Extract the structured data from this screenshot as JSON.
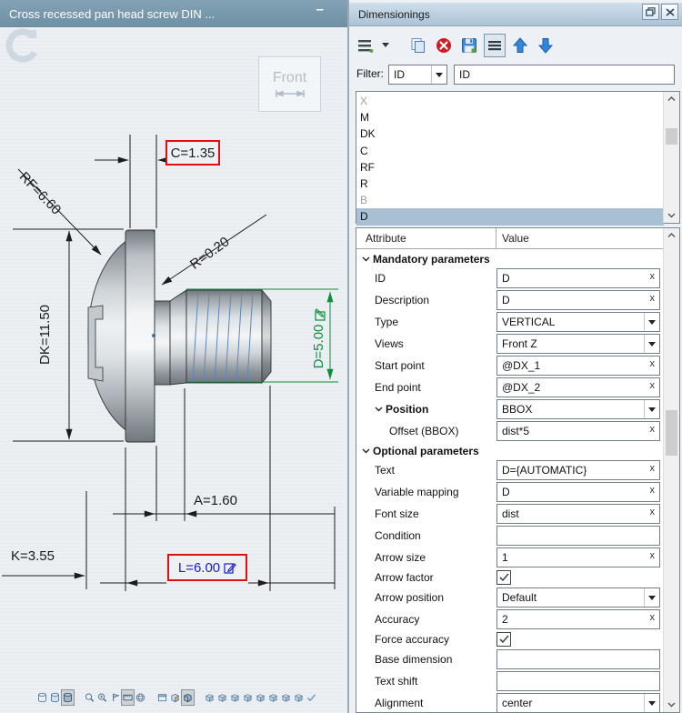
{
  "viewport": {
    "title": "Cross recessed pan head screw DIN ...",
    "minimize_glyph": "–",
    "front_badge_label": "Front",
    "dimension_labels": {
      "c": "C=1.35",
      "rf": "RF=6.60",
      "r": "R=0.20",
      "dk": "DK=11.50",
      "d": "D=5.00",
      "a": "A=1.60",
      "k": "K=3.55",
      "l": "L=6.00"
    },
    "bottom_toolbar": [
      {
        "name": "wireframe-view",
        "pressed": false
      },
      {
        "name": "shaded-view",
        "pressed": false
      },
      {
        "name": "shaded-edges-view",
        "pressed": true
      },
      {
        "name": "zoom",
        "pressed": false,
        "gap": true
      },
      {
        "name": "zoom-fit",
        "pressed": false
      },
      {
        "name": "orientation",
        "pressed": false
      },
      {
        "name": "measure",
        "pressed": true
      },
      {
        "name": "rotate-view",
        "pressed": false
      },
      {
        "name": "view-cube-window",
        "pressed": false,
        "gap": true
      },
      {
        "name": "view-cube-face",
        "pressed": false
      },
      {
        "name": "view-cube-shaded",
        "pressed": true
      },
      {
        "name": "iso-view-1",
        "pressed": false,
        "gap": true
      },
      {
        "name": "iso-view-2",
        "pressed": false
      },
      {
        "name": "iso-view-3",
        "pressed": false
      },
      {
        "name": "iso-view-4",
        "pressed": false
      },
      {
        "name": "iso-view-5",
        "pressed": false
      },
      {
        "name": "iso-view-6",
        "pressed": false
      },
      {
        "name": "iso-view-7",
        "pressed": false
      },
      {
        "name": "iso-view-8",
        "pressed": false
      },
      {
        "name": "confirm-check",
        "pressed": false
      }
    ]
  },
  "panel": {
    "title": "Dimensionings",
    "window_buttons": [
      "restore",
      "close"
    ],
    "toolbar": [
      {
        "name": "view-menu",
        "pressed": false
      },
      {
        "name": "menu-caret",
        "pressed": false,
        "caret": true
      },
      {
        "name": "copy",
        "pressed": false,
        "gap": true
      },
      {
        "name": "delete",
        "pressed": false
      },
      {
        "name": "save",
        "pressed": false
      },
      {
        "name": "list-view",
        "pressed": true
      },
      {
        "name": "move-up",
        "pressed": false
      },
      {
        "name": "move-down",
        "pressed": false
      }
    ],
    "filter": {
      "label": "Filter:",
      "combo_value": "ID",
      "input_value": "ID"
    },
    "list": {
      "items": [
        {
          "text": "X",
          "state": "disabled"
        },
        {
          "text": "M",
          "state": "normal"
        },
        {
          "text": "DK",
          "state": "normal"
        },
        {
          "text": "C",
          "state": "normal"
        },
        {
          "text": "RF",
          "state": "normal"
        },
        {
          "text": "R",
          "state": "normal"
        },
        {
          "text": "B",
          "state": "disabled"
        },
        {
          "text": "D",
          "state": "selected"
        }
      ]
    },
    "table": {
      "headers": [
        "Attribute",
        "Value"
      ],
      "rows": [
        {
          "label": "Mandatory parameters",
          "control": "group"
        },
        {
          "label": "ID",
          "value": "D",
          "control": "input-x",
          "indent": 1
        },
        {
          "label": "Description",
          "value": "D",
          "control": "input-x",
          "indent": 1
        },
        {
          "label": "Type",
          "value": "VERTICAL",
          "control": "combo",
          "indent": 1
        },
        {
          "label": "Views",
          "value": "Front Z",
          "control": "combo",
          "indent": 1
        },
        {
          "label": "Start point",
          "value": "@DX_1",
          "control": "input-x",
          "indent": 1
        },
        {
          "label": "End point",
          "value": "@DX_2",
          "control": "input-x",
          "indent": 1
        },
        {
          "label": "Position",
          "value": "BBOX",
          "control": "combo",
          "indent": 1,
          "expandable": true
        },
        {
          "label": "Offset (BBOX)",
          "value": "dist*5",
          "control": "input-x",
          "indent": 2
        },
        {
          "label": "Optional parameters",
          "control": "group"
        },
        {
          "label": "Text",
          "value": "D={AUTOMATIC}",
          "control": "input-x",
          "indent": 1
        },
        {
          "label": "Variable mapping",
          "value": "D",
          "control": "input-x",
          "indent": 1
        },
        {
          "label": "Font size",
          "value": "dist",
          "control": "input-x",
          "indent": 1
        },
        {
          "label": "Condition",
          "value": "",
          "control": "input",
          "indent": 1
        },
        {
          "label": "Arrow size",
          "value": "1",
          "control": "input-x",
          "indent": 1
        },
        {
          "label": "Arrow factor",
          "value": true,
          "control": "checkbox",
          "indent": 1
        },
        {
          "label": "Arrow position",
          "value": "Default",
          "control": "combo",
          "indent": 1
        },
        {
          "label": "Accuracy",
          "value": "2",
          "control": "input-x",
          "indent": 1
        },
        {
          "label": "Force accuracy",
          "value": true,
          "control": "checkbox",
          "indent": 1
        },
        {
          "label": "Base dimension",
          "value": "",
          "control": "input",
          "indent": 1
        },
        {
          "label": "Text shift",
          "value": "",
          "control": "input",
          "indent": 1
        },
        {
          "label": "Alignment",
          "value": "center",
          "control": "combo",
          "indent": 1
        }
      ]
    }
  },
  "colors": {
    "highlight_red": "#e01010",
    "dimension_green": "#0a8f3c",
    "editable_blue": "#1a1ac8",
    "selected_row": "#a8c0d2",
    "titlebar_blue": "#7b99ac"
  }
}
